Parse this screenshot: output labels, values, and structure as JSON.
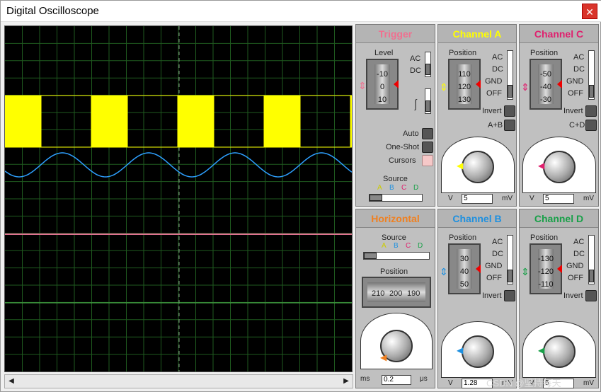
{
  "window": {
    "title": "Digital Oscilloscope",
    "close_label": "✕"
  },
  "trigger": {
    "header": "Trigger",
    "header_color": "#f07090",
    "level_label": "Level",
    "level_ticks": [
      "-10",
      "0",
      "10"
    ],
    "coupling": [
      "AC",
      "DC"
    ],
    "modes": [
      "Auto",
      "One-Shot",
      "Cursors"
    ],
    "source_label": "Source",
    "source_options": [
      "A",
      "B",
      "C",
      "D"
    ]
  },
  "channel_a": {
    "header": "Channel A",
    "header_color": "#ffff00",
    "position_label": "Position",
    "position_ticks": [
      "110",
      "120",
      "130"
    ],
    "coupling": [
      "AC",
      "DC",
      "GND",
      "OFF"
    ],
    "invert_label": "Invert",
    "combine_label": "A+B",
    "dial_left_unit": "V",
    "dial_right_unit": "mV",
    "value": "5",
    "accent": "#ffff00"
  },
  "channel_c": {
    "header": "Channel C",
    "header_color": "#e0206e",
    "position_label": "Position",
    "position_ticks": [
      "-50",
      "-40",
      "-30"
    ],
    "coupling": [
      "AC",
      "DC",
      "GND",
      "OFF"
    ],
    "invert_label": "Invert",
    "combine_label": "C+D",
    "dial_left_unit": "V",
    "dial_right_unit": "mV",
    "value": "5",
    "accent": "#e0206e"
  },
  "horizontal": {
    "header": "Horizontal",
    "header_color": "#f08020",
    "source_label": "Source",
    "source_options": [
      "A",
      "B",
      "C",
      "D"
    ],
    "position_label": "Position",
    "position_ticks": [
      "210",
      "200",
      "190"
    ],
    "dial_left_unit": "ms",
    "dial_right_unit": "μs",
    "value": "0.2",
    "accent": "#f08020"
  },
  "channel_b": {
    "header": "Channel B",
    "header_color": "#1e90e0",
    "position_label": "Position",
    "position_ticks": [
      "30",
      "40",
      "50"
    ],
    "coupling": [
      "AC",
      "DC",
      "GND",
      "OFF"
    ],
    "invert_label": "Invert",
    "dial_left_unit": "V",
    "dial_right_unit": "mV",
    "value": "1.28",
    "accent": "#1e90e0"
  },
  "channel_d": {
    "header": "Channel D",
    "header_color": "#18a048",
    "position_label": "Position",
    "position_ticks": [
      "-130",
      "-120",
      "-110"
    ],
    "coupling": [
      "AC",
      "DC",
      "GND",
      "OFF"
    ],
    "invert_label": "Invert",
    "dial_left_unit": "V",
    "dial_right_unit": "mV",
    "value": "5",
    "accent": "#18a048"
  },
  "watermark": "CSDN @坚持每天"
}
